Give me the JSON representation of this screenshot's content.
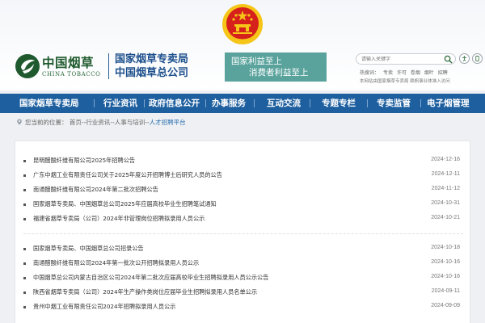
{
  "header": {
    "logo_cn": "中国烟草",
    "logo_en": "CHINA TOBACCO",
    "agency_line1": "国家烟草专卖局",
    "agency_line2": "中国烟草总公司",
    "slogan_line1": "国家利益至上",
    "slogan_line2": "消费者利益至上",
    "search_placeholder": "请输入关键字",
    "hot_label": "热搜词：",
    "hot_words": [
      "专卖",
      "许可",
      "卷烟",
      "烟叶",
      "招聘"
    ],
    "login_text": "本网站由国家烟草专卖局        赖帆事业体准入访问"
  },
  "nav": {
    "items": [
      "国家烟草专卖局",
      "行业资讯",
      "政府信息公开",
      "办事服务",
      "互动交流",
      "专题专栏",
      "专卖监管",
      "电子烟管理"
    ]
  },
  "breadcrumb": {
    "label": "您当前的位置：",
    "path": "首页--行业资讯--人事与培训--",
    "current": "人才招聘平台"
  },
  "list": {
    "group1": [
      {
        "title": "昆明醋酸纤维有限公司2025年招聘公告",
        "date": "2024-12-16"
      },
      {
        "title": "广东中烟工业有限责任公司关于2025年度公开招聘博士后研究人员的公告",
        "date": "2024-12-11"
      },
      {
        "title": "南通醋酸纤维有限公司2024年第二批次招聘公告",
        "date": "2024-11-12"
      },
      {
        "title": "国家烟草专卖局、中国烟草总公司2025年应届高校毕业生招聘笔试通知",
        "date": "2024-10-31"
      },
      {
        "title": "福建省烟草专卖局（公司）2024年非管理岗位招聘拟录用人员公示",
        "date": "2024-10-21"
      }
    ],
    "group2": [
      {
        "title": "国家烟草专卖局、中国烟草总公司招录公告",
        "date": "2024-10-18"
      },
      {
        "title": "南通醋酸纤维有限公司2024年第一批次公开招聘拟录用人员公示",
        "date": "2024-10-16"
      },
      {
        "title": "中国烟草总公司内蒙古自治区公司2024年第二批次应届高校毕业生招聘拟录用人员公示公告",
        "date": "2024-10-16"
      },
      {
        "title": "陕西省烟草专卖局（公司）2024年生产操作类岗位应届毕业生招聘拟录用人员名单公示",
        "date": "2024-09-11"
      },
      {
        "title": "贵州中烟工业有限责任公司2024年招聘拟录用人员公示",
        "date": "2024-09-09"
      }
    ]
  },
  "colors": {
    "nav_bg": "#1e5f9f",
    "brand_green": "#1f5a2e",
    "agency_blue": "#1d4f8c",
    "slogan_bg": "#5aa39c",
    "emblem_red": "#d6201b",
    "emblem_gold": "#f5c518"
  }
}
